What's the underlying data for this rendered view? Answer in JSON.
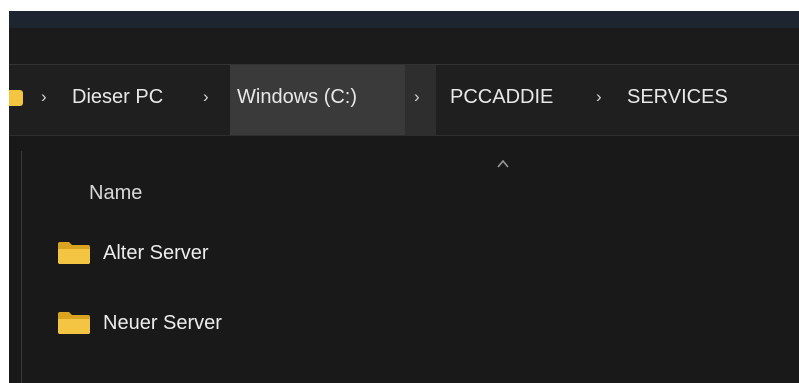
{
  "breadcrumb": {
    "separator": "›",
    "items": [
      {
        "label": "Dieser PC"
      },
      {
        "label": "Windows (C:)"
      },
      {
        "label": "PCCADDIE"
      },
      {
        "label": "SERVICES"
      }
    ]
  },
  "file_list": {
    "column_header": "Name",
    "rows": [
      {
        "name": "Alter Server"
      },
      {
        "name": "Neuer Server"
      }
    ]
  },
  "colors": {
    "folder": "#f4c542",
    "folder_dark": "#d9a520",
    "background": "#191919",
    "text": "#e8e8e8"
  },
  "icons": {
    "folder": "folder-icon",
    "sort": "chevron-up-icon"
  }
}
